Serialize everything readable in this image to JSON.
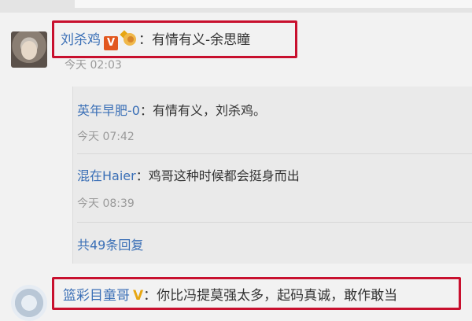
{
  "comment1": {
    "username": "刘杀鸡",
    "badge_v": "V",
    "text": "：有情有义-余思瞳",
    "time": "今天 02:03"
  },
  "replies": [
    {
      "username": "英年早肥-0",
      "text": "：有情有义，刘杀鸡。",
      "time": "今天 07:42"
    },
    {
      "username": "混在Haier",
      "text": "：鸡哥这种时候都会挺身而出",
      "time": "今天 08:39"
    }
  ],
  "more_replies": "共49条回复",
  "comment2": {
    "username": "篮彩目童哥",
    "badge_v": "V",
    "text": "：你比冯提莫强太多，起码真诚，敢作敢当"
  },
  "colors": {
    "username_blue": "#3a6fb6",
    "highlight_red": "#c8102e",
    "verified_orange": "#e2571e",
    "verified_yellow": "#e7a612"
  }
}
